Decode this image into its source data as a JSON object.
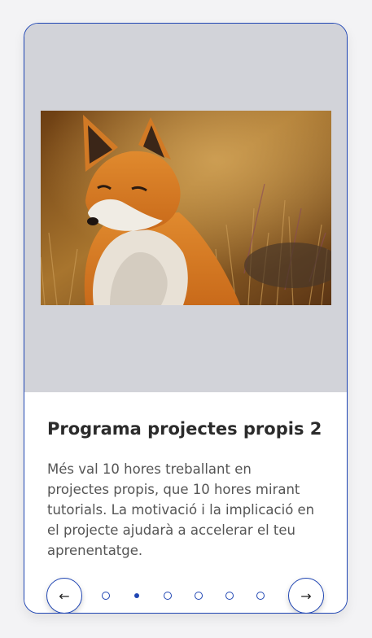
{
  "card": {
    "title": "Programa projectes propis 2",
    "description": "Més val 10 hores treballant en projectes propis, que 10 hores mirant tutorials. La motivació i la implicació en el projecte ajudarà a accelerar el teu aprenentatge.",
    "image_subject": "red fox sitting in dry grass",
    "prev_label": "←",
    "next_label": "→"
  },
  "pagination": {
    "total": 6,
    "active_index": 1
  },
  "colors": {
    "accent": "#1f45b3",
    "media_bg": "#d2d3d9",
    "title": "#2b2b2b",
    "text": "#555555"
  }
}
